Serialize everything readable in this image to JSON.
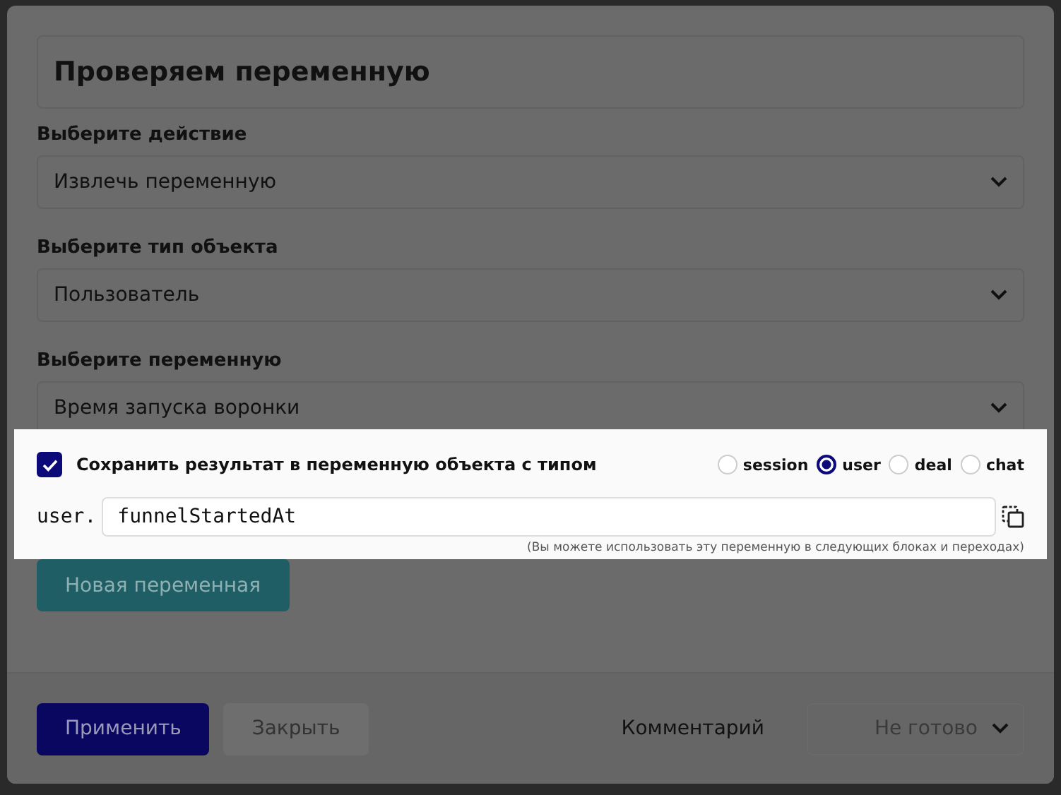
{
  "title": "Проверяем переменную",
  "fields": [
    {
      "label": "Выберите действие",
      "value": "Извлечь переменную"
    },
    {
      "label": "Выберите тип объекта",
      "value": "Пользователь"
    },
    {
      "label": "Выберите переменную",
      "value": "Время запуска воронки"
    }
  ],
  "save_option": {
    "label": "Сохранить результат в переменную объекта с типом",
    "checked": true,
    "types": [
      {
        "label": "session",
        "selected": false
      },
      {
        "label": "user",
        "selected": true
      },
      {
        "label": "deal",
        "selected": false
      },
      {
        "label": "chat",
        "selected": false
      }
    ]
  },
  "variable": {
    "prefix": "user.",
    "value": "funnelStartedAt",
    "hint": "(Вы можете использовать эту переменную в следующих блоках и переходах)"
  },
  "new_variable_button": "Новая переменная",
  "footer": {
    "apply": "Применить",
    "close": "Закрыть",
    "comment_label": "Комментарий",
    "status": "Не готово"
  }
}
